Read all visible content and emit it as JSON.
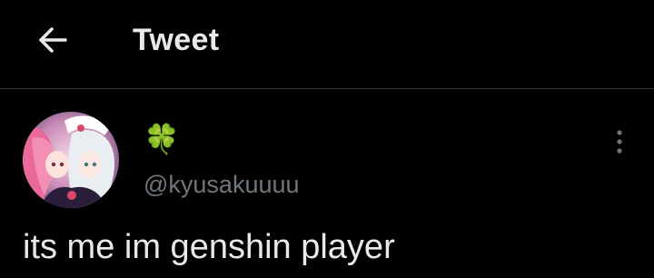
{
  "header": {
    "back_icon": "arrow-left-icon",
    "title": "Tweet"
  },
  "tweet": {
    "author": {
      "display_name": "🍀",
      "handle": "@kyusakuuuu",
      "avatar_icon": "avatar-image"
    },
    "more_icon": "more-vertical-icon",
    "text": "its me im genshin player"
  },
  "colors": {
    "background": "#000000",
    "text_primary": "#e7e9ea",
    "text_secondary": "#71767b",
    "divider": "#2f3336",
    "clover": "#3dab3d"
  }
}
